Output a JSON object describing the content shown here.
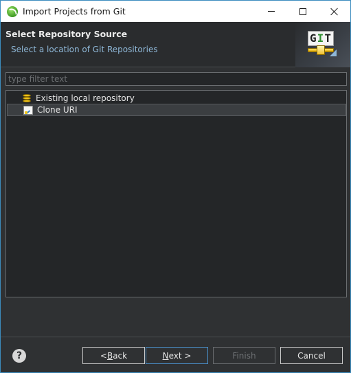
{
  "window": {
    "title": "Import Projects from Git"
  },
  "banner": {
    "title": "Select Repository Source",
    "subtitle": "Select a location of Git Repositories",
    "logo_text_g": "G",
    "logo_text_i": "I",
    "logo_text_t": "T"
  },
  "filter": {
    "placeholder": "type filter text",
    "value": ""
  },
  "tree": {
    "items": [
      {
        "label": "Existing local repository",
        "icon": "database-icon",
        "selected": false
      },
      {
        "label": "Clone URI",
        "icon": "clone-uri-icon",
        "selected": true
      }
    ]
  },
  "buttons": {
    "help": "?",
    "back_prefix": "< ",
    "back_mnemonic": "B",
    "back_rest": "ack",
    "next_mnemonic": "N",
    "next_rest": "ext >",
    "finish": "Finish",
    "cancel": "Cancel"
  },
  "colors": {
    "accent": "#4a8fc8",
    "subtitle": "#8fb8d8",
    "background": "#2f3133"
  }
}
